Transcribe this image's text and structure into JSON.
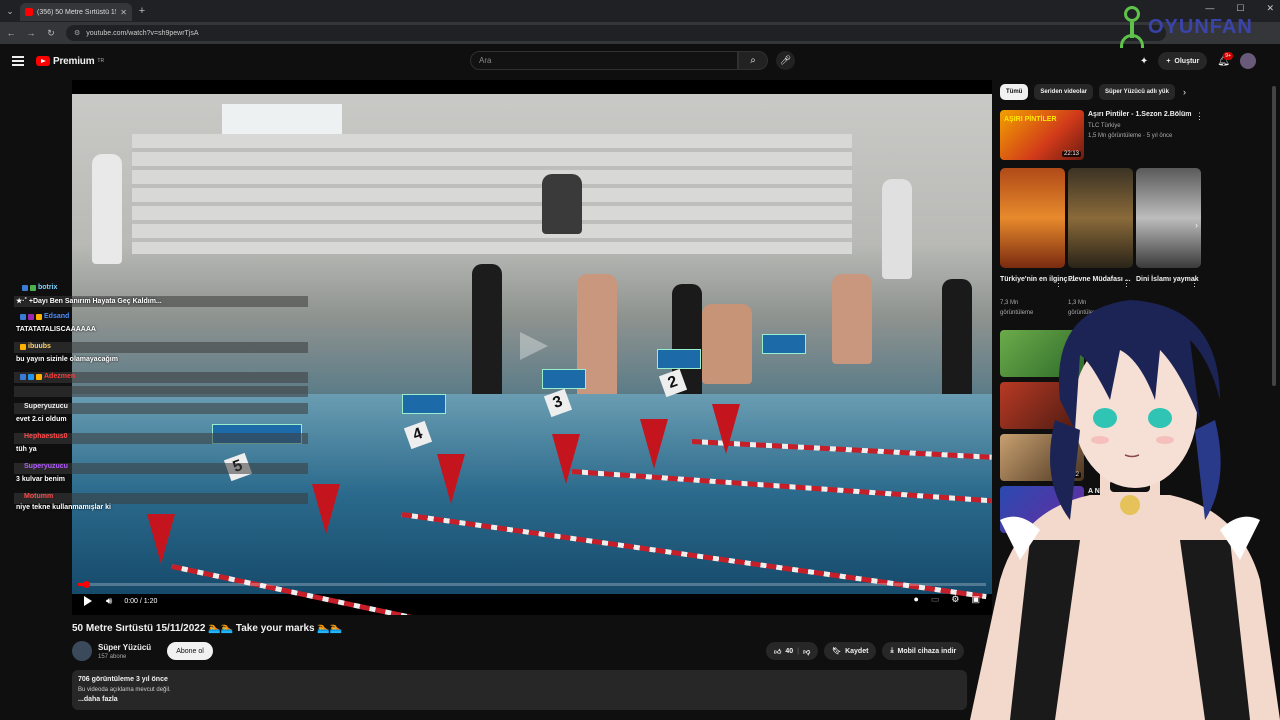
{
  "browser": {
    "tab_title": "(356) 50 Metre Sırtüstü 15/11/...",
    "url": "youtube.com/watch?v=sh9pewrTjsA"
  },
  "watermark": {
    "text": "OYUNFAN"
  },
  "header": {
    "logo_text": "Premium",
    "logo_sup": "TR",
    "search_placeholder": "Ara",
    "create_label": "Oluştur",
    "notif_badge": "9+"
  },
  "player": {
    "time": "0:00 / 1:20",
    "progress": 0.005,
    "lane_numbers": [
      "2",
      "3",
      "4",
      "5"
    ]
  },
  "chat": [
    {
      "user": "botrix",
      "user_color": "#7fd1ff",
      "msg": "+Dayı Ben Sanırım Hayata Geç Kaldım..."
    },
    {
      "user": "Edsand",
      "user_color": "#4f8dff",
      "msg": "TATATATALISCAAAAAA"
    },
    {
      "user": "ibuubs",
      "user_color": "#ffd36b",
      "msg": "bu yayın sizinle olamayacağım"
    },
    {
      "user": "Adezmen",
      "user_color": "#ff3b3b",
      "msg": ""
    },
    {
      "user": "Superyuzucu",
      "user_color": "#b35cff",
      "msg": "evet 2.ci oldum"
    },
    {
      "user": "Hephaestus0",
      "user_color": "#ff4a4a",
      "msg": "tüh ya"
    },
    {
      "user": "Superyuzucu",
      "user_color": "#b35cff",
      "msg": "3 kulvar benim"
    },
    {
      "user": "Motumm",
      "user_color": "#ff4a4a",
      "msg": "niye tekne kullanmamışlar ki"
    }
  ],
  "video": {
    "title": "50 Metre Sırtüstü 15/11/2022 🏊🏊 Take your marks 🏊🏊",
    "channel": "Süper Yüzücü",
    "subs": "157 abone",
    "subscribe_label": "Abone ol",
    "likes": "40",
    "save_label": "Kaydet",
    "download_label": "Mobil cihaza indir",
    "views_date": "706 görüntüleme  3 yıl önce",
    "desc_text": "Bu videoda açıklama mevcut değil.",
    "more_label": "...daha fazla"
  },
  "sidebar": {
    "chips": [
      "Tümü",
      "Seriden videolar",
      "Süper Yüzücü adlı yük"
    ],
    "rec1": {
      "title": "Aşırı Pintiler - 1.Sezon 2.Bölüm",
      "channel": "TLC Türkiye",
      "meta": "1,5 Mn görüntüleme · 5 yıl önce",
      "duration": "22:13",
      "thumb_label": "AŞIRI PİNTİLER"
    },
    "shorts": [
      {
        "title": "Türkiye'nin en ilginç ...",
        "meta": "7,3 Mn",
        "meta2": "görüntüleme"
      },
      {
        "title": "Plevne Müdafası ...",
        "meta": "1,3 Mn",
        "meta2": "görüntüleme"
      },
      {
        "title": "Dini İslamı yaymak",
        "meta": "",
        "meta2": ""
      }
    ],
    "small_dur": "9:22",
    "partial_title": "A N..."
  },
  "colors": {
    "brand_red": "#ff0000",
    "bg": "#0f0f0f"
  }
}
